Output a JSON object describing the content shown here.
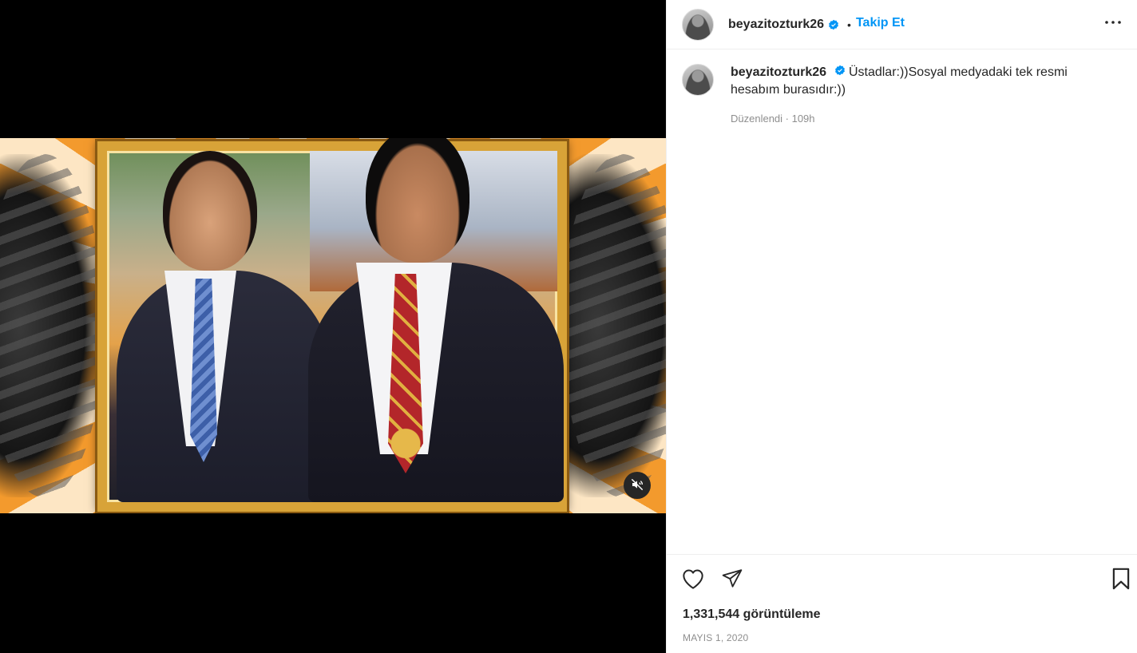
{
  "post": {
    "username": "beyazitozturk26",
    "verified": true,
    "follow_label": "Takip Et",
    "caption": "Üstadlar:))Sosyal medyadaki tek resmi hesabım burasıdır:))",
    "caption_meta": "Düzenlendi · 109h",
    "views": "1,331,544 görüntüleme",
    "date": "MAYIS 1, 2020"
  },
  "colors": {
    "link": "#0095f6",
    "verified": "#0095f6",
    "muted": "#8e8e8e",
    "text": "#262626"
  },
  "icons": {
    "header_menu": "more-dots-icon",
    "verified": "verified-badge-icon",
    "like": "heart-icon",
    "share": "paper-plane-icon",
    "save": "bookmark-icon",
    "mute": "muted-speaker-icon"
  }
}
